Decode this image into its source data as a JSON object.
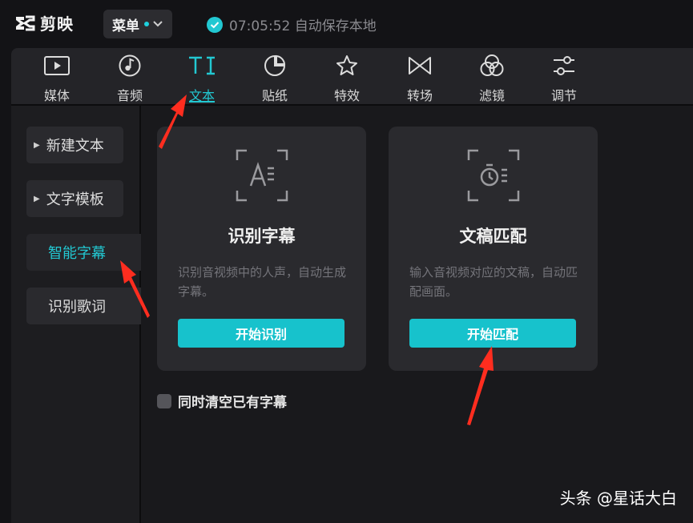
{
  "app": {
    "logo_text": "剪映"
  },
  "header": {
    "menu_label": "菜单",
    "save_status": "07:05:52 自动保存本地"
  },
  "tabs": [
    {
      "label": "媒体",
      "icon": "media-play-icon"
    },
    {
      "label": "音频",
      "icon": "audio-note-icon"
    },
    {
      "label": "文本",
      "icon": "text-ti-icon",
      "active": true
    },
    {
      "label": "贴纸",
      "icon": "sticker-icon"
    },
    {
      "label": "特效",
      "icon": "effects-star-icon"
    },
    {
      "label": "转场",
      "icon": "transition-bowtie-icon"
    },
    {
      "label": "滤镜",
      "icon": "filter-circles-icon"
    },
    {
      "label": "调节",
      "icon": "adjust-sliders-icon"
    }
  ],
  "sidebar": {
    "items": [
      {
        "label": "新建文本"
      },
      {
        "label": "文字模板"
      },
      {
        "label": "智能字幕",
        "active": true
      },
      {
        "label": "识别歌词"
      }
    ]
  },
  "cards": [
    {
      "title": "识别字幕",
      "desc": "识别音视频中的人声，自动生成字幕。",
      "button": "开始识别"
    },
    {
      "title": "文稿匹配",
      "desc": "输入音视频对应的文稿，自动匹配画面。",
      "button": "开始匹配"
    }
  ],
  "options": {
    "clear_existing_label": "同时清空已有字幕"
  },
  "watermark": "头条 @星话大白",
  "colors": {
    "accent": "#22c8d2",
    "button": "#17c2cc",
    "annotation": "#ff2d1f"
  }
}
